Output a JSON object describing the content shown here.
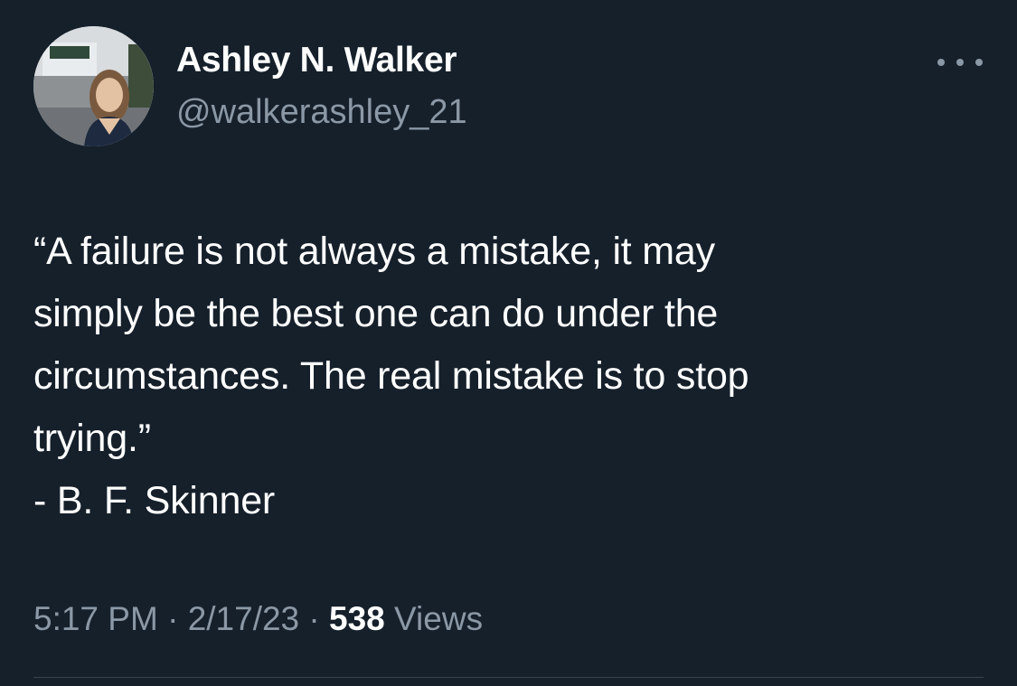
{
  "author": {
    "display_name": "Ashley N. Walker",
    "handle": "@walkerashley_21",
    "avatar_icon": "profile-photo"
  },
  "tweet": {
    "lines": [
      "“A failure is not always a mistake, it may",
      "simply be the best one can do under the",
      "circumstances. The real mistake is to stop",
      "trying.”",
      "- B. F. Skinner"
    ]
  },
  "meta": {
    "time": "5:17 PM",
    "separator": " · ",
    "date": "2/17/23",
    "views_count": "538",
    "views_label": "Views"
  },
  "colors": {
    "background": "#15202b",
    "primary_text": "#ffffff",
    "secondary_text": "#8b98a5",
    "divider": "#38444d"
  },
  "more_icon": "more-horizontal-icon"
}
